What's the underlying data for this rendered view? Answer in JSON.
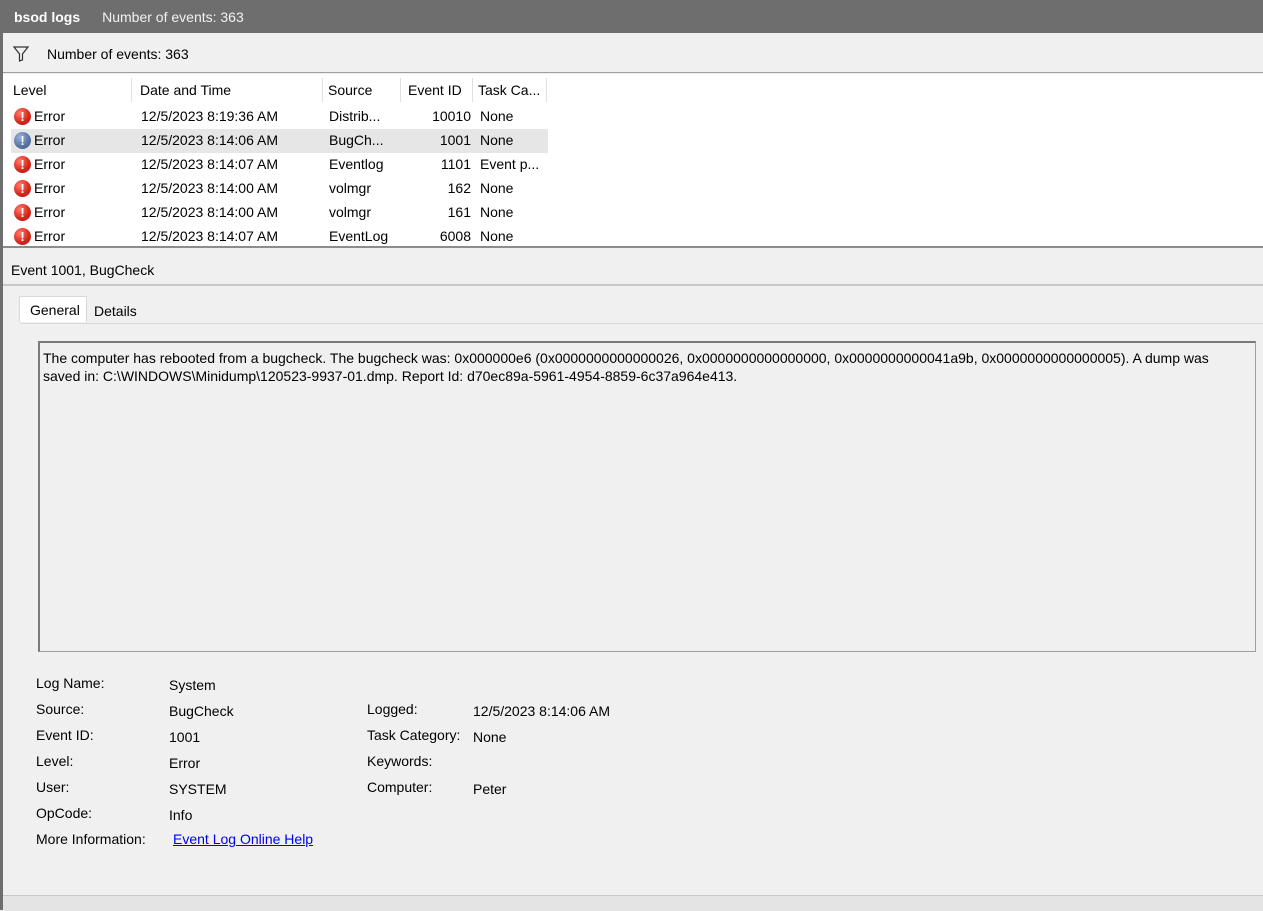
{
  "title_bar": {
    "log_name": "bsod logs",
    "event_count": "Number of events: 363"
  },
  "filter_bar": {
    "icon": "filter-icon",
    "event_count": "Number of events: 363"
  },
  "table": {
    "headers": [
      "Level",
      "Date and Time",
      "Source",
      "Event ID",
      "Task Ca..."
    ],
    "rows": [
      {
        "level": "Error",
        "date": "12/5/2023 8:19:36 AM",
        "source": "Distrib...",
        "event_id": "10010",
        "task": "None"
      },
      {
        "level": "Error",
        "date": "12/5/2023 8:14:06 AM",
        "source": "BugCh...",
        "event_id": "1001",
        "task": "None"
      },
      {
        "level": "Error",
        "date": "12/5/2023 8:14:07 AM",
        "source": "Eventlog",
        "event_id": "1101",
        "task": "Event p..."
      },
      {
        "level": "Error",
        "date": "12/5/2023 8:14:00 AM",
        "source": "volmgr",
        "event_id": "162",
        "task": "None"
      },
      {
        "level": "Error",
        "date": "12/5/2023 8:14:00 AM",
        "source": "volmgr",
        "event_id": "161",
        "task": "None"
      },
      {
        "level": "Error",
        "date": "12/5/2023 8:14:07 AM",
        "source": "EventLog",
        "event_id": "6008",
        "task": "None"
      }
    ],
    "selected_row": 1
  },
  "detail": {
    "header": "Event 1001, BugCheck",
    "tabs": [
      "General",
      "Details"
    ],
    "message": "The computer has rebooted from a bugcheck.  The bugcheck was: 0x000000e6 (0x0000000000000026, 0x0000000000000000, 0x0000000000041a9b, 0x0000000000000005). A dump was saved in: C:\\WINDOWS\\Minidump\\120523-9937-01.dmp. Report Id: d70ec89a-5961-4954-8859-6c37a964e413.",
    "properties": {
      "log_name_label": "Log Name:",
      "log_name": "System",
      "source_label": "Source:",
      "source": "BugCheck",
      "logged_label": "Logged:",
      "logged": "12/5/2023 8:14:06 AM",
      "event_id_label": "Event ID:",
      "event_id": "1001",
      "task_category_label": "Task Category:",
      "task_category": "None",
      "level_label": "Level:",
      "level": "Error",
      "keywords_label": "Keywords:",
      "keywords": "",
      "user_label": "User:",
      "user": "SYSTEM",
      "computer_label": "Computer:",
      "computer": "Peter",
      "opcode_label": "OpCode:",
      "opcode": "Info",
      "more_info_label": "More Information:",
      "more_info_link": "Event Log Online Help"
    }
  },
  "colors": {
    "title_bar": "#6e6e6e",
    "error_icon": "#d52b1e",
    "link": "#0000ee",
    "selected_row": "#e6e6e6"
  }
}
